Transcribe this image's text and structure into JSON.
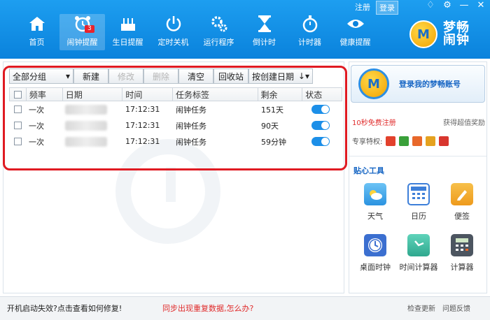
{
  "header": {
    "register_label": "注册",
    "login_label": "登录",
    "nav": [
      {
        "label": "首页",
        "icon": "home-icon"
      },
      {
        "label": "闹钟提醒",
        "icon": "alarm-clock-icon",
        "badge": "3",
        "active": true
      },
      {
        "label": "生日提醒",
        "icon": "birthday-cake-icon"
      },
      {
        "label": "定时关机",
        "icon": "power-icon"
      },
      {
        "label": "运行程序",
        "icon": "gears-icon"
      },
      {
        "label": "倒计时",
        "icon": "hourglass-icon"
      },
      {
        "label": "计时器",
        "icon": "stopwatch-icon"
      },
      {
        "label": "健康提醒",
        "icon": "eye-icon"
      }
    ],
    "logo_line1": "梦畅",
    "logo_line2": "闹钟"
  },
  "toolbar": {
    "group_value": "全部分组",
    "new_label": "新建",
    "edit_label": "修改",
    "delete_label": "删除",
    "clear_label": "清空",
    "recycle_label": "回收站",
    "sort_value": "按创建日期"
  },
  "table": {
    "headers": [
      "频率",
      "日期",
      "时间",
      "任务标签",
      "剩余",
      "状态"
    ],
    "rows": [
      {
        "frequency": "一次",
        "time": "17:12:31",
        "label": "闹钟任务",
        "remaining": "151天",
        "enabled": true
      },
      {
        "frequency": "一次",
        "time": "17:12:31",
        "label": "闹钟任务",
        "remaining": "90天",
        "enabled": true
      },
      {
        "frequency": "一次",
        "time": "17:12:31",
        "label": "闹钟任务",
        "remaining": "59分钟",
        "enabled": true
      }
    ]
  },
  "sidebar": {
    "login_card_text": "登录我的梦畅账号",
    "promo_register": "10秒免费注册",
    "promo_reward": "获得超值奖励",
    "privilege_label": "专享特权:",
    "tools_title": "贴心工具",
    "tools": [
      {
        "label": "天气",
        "icon": "weather-icon",
        "color": "#39a7ec"
      },
      {
        "label": "日历",
        "icon": "calendar-icon",
        "color": "#3d7fd9"
      },
      {
        "label": "便签",
        "icon": "note-pencil-icon",
        "color": "#f0a02a"
      },
      {
        "label": "桌面时钟",
        "icon": "desktop-clock-icon",
        "color": "#3b6fd0"
      },
      {
        "label": "时间计算器",
        "icon": "time-calculator-icon",
        "color": "#36b59e"
      },
      {
        "label": "计算器",
        "icon": "calculator-icon",
        "color": "#555f6b"
      }
    ]
  },
  "status": {
    "startup_fail": "开机启动失效?点击查看如何修复!",
    "duplicate_data": "同步出现重复数据,怎么办?",
    "check_update": "检查更新",
    "feedback": "问题反馈"
  },
  "colors": {
    "header_blue": "#0a82dc",
    "highlight_red": "#e01a22",
    "toggle_blue": "#1c8fe8"
  }
}
